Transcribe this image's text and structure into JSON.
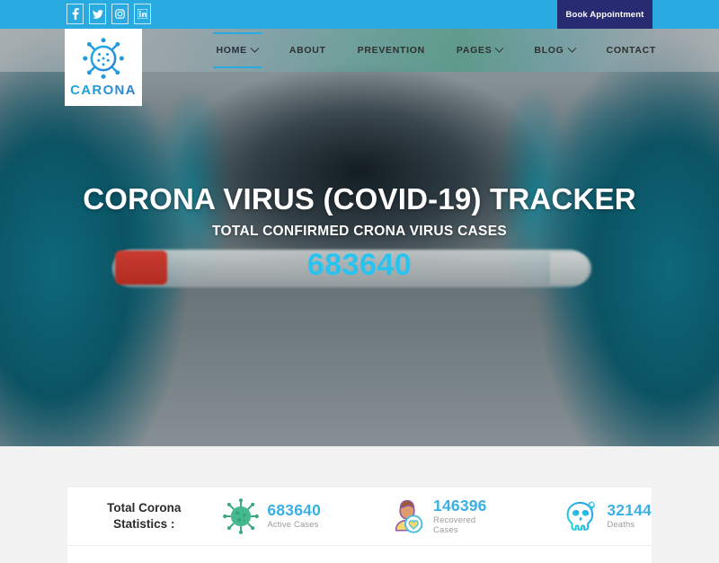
{
  "topbar": {
    "social": [
      {
        "name": "facebook-icon",
        "label": "Facebook"
      },
      {
        "name": "twitter-icon",
        "label": "Twitter"
      },
      {
        "name": "instagram-icon",
        "label": "Instagram"
      },
      {
        "name": "linkedin-icon",
        "label": "LinkedIn"
      }
    ],
    "book_label": "Book Appointment",
    "bar_color": "#29abe2",
    "book_color": "#282b72"
  },
  "logo": {
    "word": "CARONA",
    "icon": "virus-icon",
    "gradient_from": "#18a9dd",
    "gradient_to": "#2f7fd0"
  },
  "nav": {
    "items": [
      {
        "label": "HOME",
        "has_caret": true,
        "active": true
      },
      {
        "label": "ABOUT",
        "has_caret": false,
        "active": false
      },
      {
        "label": "PREVENTION",
        "has_caret": false,
        "active": false
      },
      {
        "label": "PAGES",
        "has_caret": true,
        "active": false
      },
      {
        "label": "BLOG",
        "has_caret": true,
        "active": false
      },
      {
        "label": "CONTACT",
        "has_caret": false,
        "active": false
      }
    ],
    "active_underline_color": "#29abe2"
  },
  "hero": {
    "title": "CORONA VIRUS (COVID-19) TRACKER",
    "subtitle": "TOTAL CONFIRMED CRONA VIRUS CASES",
    "count": "683640",
    "count_color": "#29c3f0"
  },
  "stats": {
    "heading_line1": "Total Corona",
    "heading_line2": "Statistics :",
    "items": [
      {
        "icon": "virus-icon",
        "value": "683640",
        "label": "Active Cases",
        "icon_color": "#3aa87f"
      },
      {
        "icon": "recovered-person-shield-icon",
        "value": "146396",
        "label": "Recovered Cases",
        "icon_color": "#f5d76e"
      },
      {
        "icon": "skull-gear-icon",
        "value": "32144",
        "label": "Deaths",
        "icon_color": "#32c6f4"
      }
    ],
    "value_color": "#3cb0e5",
    "label_color": "#9b9b9b"
  }
}
